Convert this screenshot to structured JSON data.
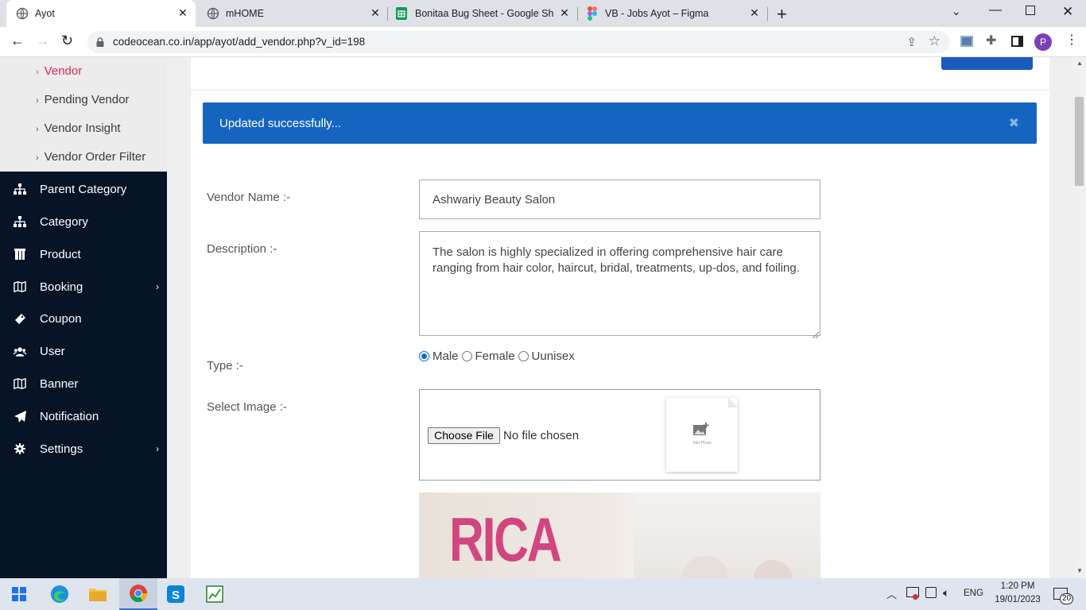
{
  "browser": {
    "tabs": [
      {
        "title": "Ayot",
        "active": true
      },
      {
        "title": "mHOME",
        "active": false
      },
      {
        "title": "Bonitaa Bug Sheet - Google Shee",
        "active": false
      },
      {
        "title": "VB - Jobs Ayot – Figma",
        "active": false
      }
    ],
    "url": "codeocean.co.in/app/ayot/add_vendor.php?v_id=198",
    "profile_initial": "P"
  },
  "sidebar": {
    "sub_items": [
      "Vendor",
      "Pending Vendor",
      "Vendor Insight",
      "Vendor Order Filter"
    ],
    "items": [
      {
        "label": "Parent Category",
        "icon": "sitemap-icon"
      },
      {
        "label": "Category",
        "icon": "sitemap-icon"
      },
      {
        "label": "Product",
        "icon": "product-icon"
      },
      {
        "label": "Booking",
        "icon": "book-icon",
        "has_arrow": true
      },
      {
        "label": "Coupon",
        "icon": "coupon-icon"
      },
      {
        "label": "User",
        "icon": "users-icon"
      },
      {
        "label": "Banner",
        "icon": "map-icon"
      },
      {
        "label": "Notification",
        "icon": "paper-plane-icon"
      },
      {
        "label": "Settings",
        "icon": "gear-icon",
        "has_arrow": true
      }
    ]
  },
  "alert": {
    "message": "Updated successfully..."
  },
  "form": {
    "vendor_name_label": "Vendor Name :-",
    "vendor_name_value": "Ashwariy Beauty Salon",
    "description_label": "Description :-",
    "description_value": "The salon is highly specialized in offering comprehensive hair care ranging from hair color, haircut, bridal, treatments, up-dos, and foiling.",
    "type_label": "Type :-",
    "type_options": [
      "Male",
      "Female",
      "Uunisex"
    ],
    "type_selected": "Male",
    "image_label": "Select Image :-",
    "choose_file": "Choose File",
    "no_file": "No file chosen",
    "add_photo": "Add Photo",
    "image_text": "RICA"
  },
  "taskbar": {
    "lang": "ENG",
    "time": "1:20 PM",
    "date": "19/01/2023",
    "notifications": "20"
  }
}
